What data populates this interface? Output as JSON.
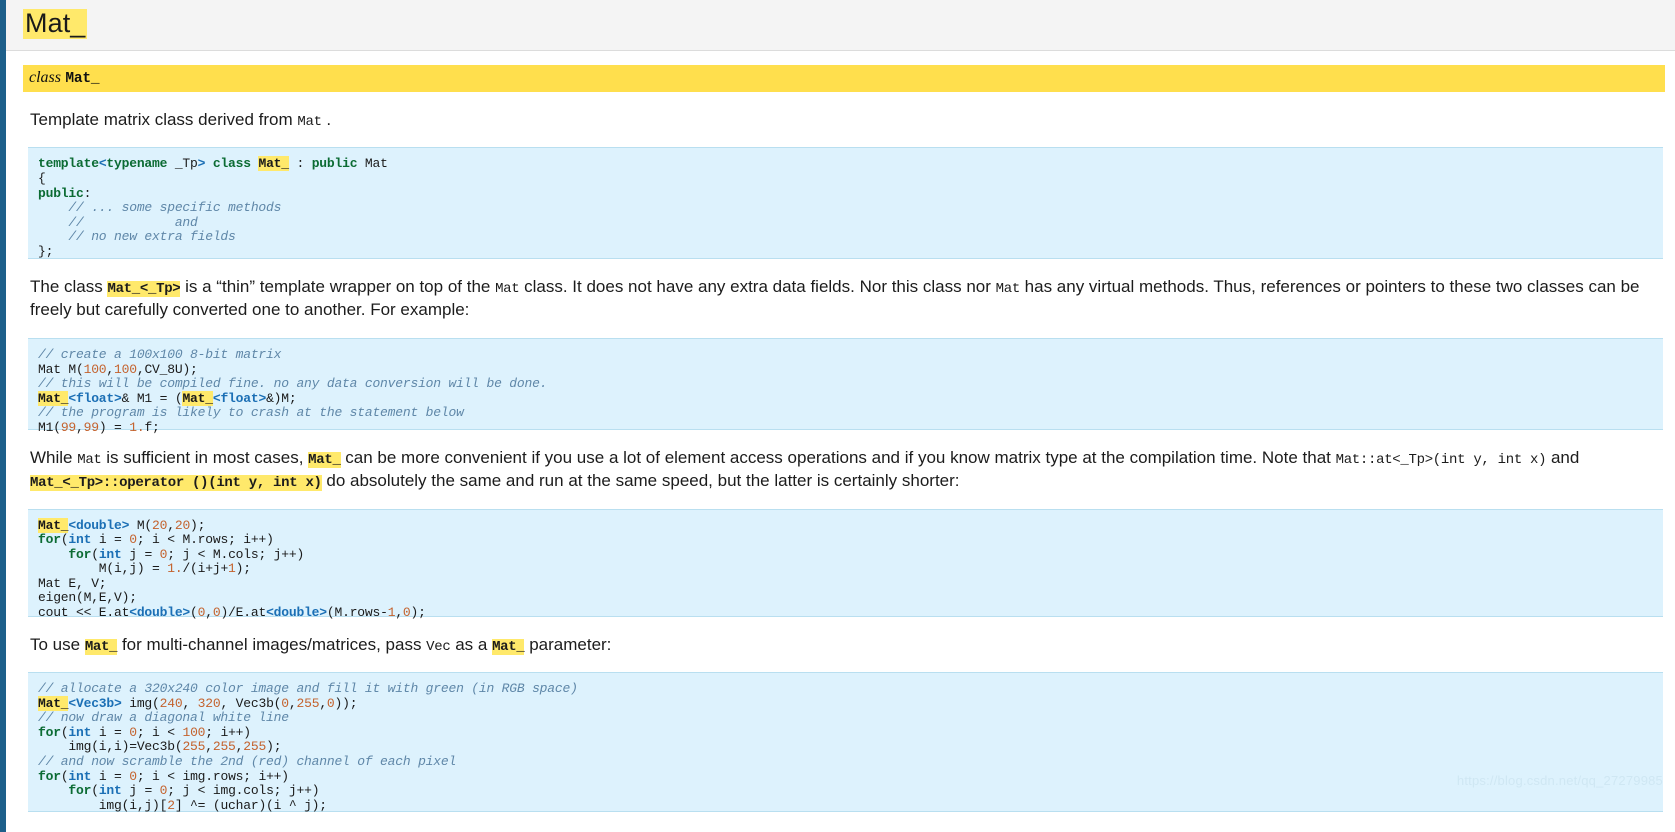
{
  "page": {
    "title": "Mat_",
    "signature": {
      "keyword": "class",
      "name": "Mat_"
    },
    "intro": {
      "before": "Template matrix class derived from ",
      "mono": "Mat",
      "after": " ."
    },
    "watermark": "https://blog.csdn.net/qq_27279985"
  },
  "code_blocks": [
    {
      "id": "class-declaration",
      "lines": [
        "template<typename _Tp> class Mat_ : public Mat",
        "{",
        "public:",
        "    // ... some specific methods",
        "    //            and",
        "    // no new extra fields",
        "};"
      ]
    },
    {
      "id": "conversion-example",
      "lines": [
        "// create a 100x100 8-bit matrix",
        "Mat M(100,100,CV_8U);",
        "// this will be compiled fine. no any data conversion will be done.",
        "Mat_<float>& M1 = (Mat_<float>&)M;",
        "// the program is likely to crash at the statement below",
        "M1(99,99) = 1.f;"
      ]
    },
    {
      "id": "element-access-example",
      "lines": [
        "Mat_<double> M(20,20);",
        "for(int i = 0; i < M.rows; i++)",
        "    for(int j = 0; j < M.cols; j++)",
        "        M(i,j) = 1./(i+j+1);",
        "Mat E, V;",
        "eigen(M,E,V);",
        "cout << E.at<double>(0,0)/E.at<double>(M.rows-1,0);"
      ]
    },
    {
      "id": "multichannel-example",
      "lines": [
        "// allocate a 320x240 color image and fill it with green (in RGB space)",
        "Mat_<Vec3b> img(240, 320, Vec3b(0,255,0));",
        "// now draw a diagonal white line",
        "for(int i = 0; i < 100; i++)",
        "    img(i,i)=Vec3b(255,255,255);",
        "// and now scramble the 2nd (red) channel of each pixel",
        "for(int i = 0; i < img.rows; i++)",
        "    for(int j = 0; j < img.cols; j++)",
        "        img(i,j)[2] ^= (uchar)(i ^ j);"
      ]
    }
  ],
  "paragraphs": {
    "thin_wrapper": {
      "p1": "The class ",
      "mat_tp": "Mat_<_Tp>",
      "p2": " is a  “thin”  template wrapper on top of the ",
      "mat": "Mat",
      "p3": " class. It does not have any extra data fields. Nor this class nor ",
      "mat2": "Mat",
      "p4": " has any virtual methods. Thus, references or pointers to these two classes can be freely but carefully converted one to another. For example:"
    },
    "while_mat": {
      "p1": "While ",
      "mat": "Mat",
      "p2": " is sufficient in most cases, ",
      "mat_": "Mat_",
      "p3": " can be more convenient if you use a lot of element access operations and if you know matrix type at the compilation time. Note that ",
      "at_sig": "Mat::at<_Tp>(int y, int x)",
      "p4": " and ",
      "op_sig": "Mat_<_Tp>::operator ()(int y, int x)",
      "p5": " do absolutely the same and run at the same speed, but the latter is certainly shorter:"
    },
    "multi_channel": {
      "p1": "To use ",
      "mat_": "Mat_",
      "p2": " for multi-channel images/matrices, pass ",
      "vec": "Vec",
      "p3": " as a ",
      "mat_2": "Mat_",
      "p4": " parameter:"
    }
  },
  "colors": {
    "highlight": "#ffe96b",
    "signature_bar": "#ffdf4d",
    "code_background": "#ddf2fd",
    "left_rail": "#1d5f8a",
    "title_band": "#f4f4f4"
  }
}
